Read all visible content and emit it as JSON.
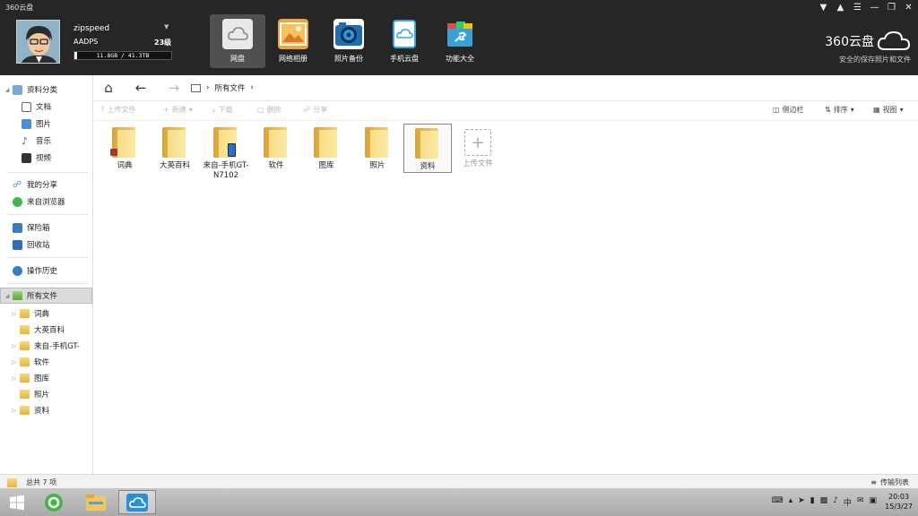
{
  "app_title": "360云盘",
  "user": {
    "name": "zipspeed",
    "level_name": "AADPS",
    "level": "23级",
    "quota_text": "11.8GB / 41.3TB",
    "quota_fraction": 0.03
  },
  "nav": [
    {
      "label": "网盘",
      "icon": "cloud-disk-icon",
      "color": "#e9e9e9"
    },
    {
      "label": "网络相册",
      "icon": "photo-album-icon",
      "color": "#f0a33b"
    },
    {
      "label": "照片备份",
      "icon": "camera-icon",
      "color": "#2a7fc3"
    },
    {
      "label": "手机云盘",
      "icon": "phone-cloud-icon",
      "color": "#37a8df"
    },
    {
      "label": "功能大全",
      "icon": "toolbox-icon",
      "color": "#3aa0d8"
    }
  ],
  "brand": {
    "name": "360云盘",
    "slogan": "安全的保存照片和文件"
  },
  "sidebar": {
    "category_title": "资料分类",
    "categories": [
      "文档",
      "图片",
      "音乐",
      "视频"
    ],
    "share_items": [
      "我的分享",
      "来自浏览器"
    ],
    "safe_items": [
      "保险箱",
      "回收站"
    ],
    "history": "操作历史",
    "all_files": "所有文件",
    "tree": [
      "词典",
      "大英百科",
      "来自-手机GT-",
      "软件",
      "图库",
      "照片",
      "资料"
    ]
  },
  "address": {
    "path": "所有文件"
  },
  "actions": {
    "upload": "上传文件",
    "new": "新建",
    "download": "下载",
    "delete": "删除",
    "share": "分享",
    "sidebar": "侧边栏",
    "sort": "排序",
    "view": "视图"
  },
  "files": [
    {
      "name": "词典"
    },
    {
      "name": "大英百科"
    },
    {
      "name": "来自-手机GT-N7102"
    },
    {
      "name": "软件"
    },
    {
      "name": "图库"
    },
    {
      "name": "照片"
    },
    {
      "name": "资料"
    }
  ],
  "upload_tile": "上传文件",
  "status": {
    "count": "总共 7 项",
    "transfer": "传输列表"
  },
  "taskbar": {
    "time": "20:03",
    "date": "15/3/27",
    "ime": "中"
  }
}
